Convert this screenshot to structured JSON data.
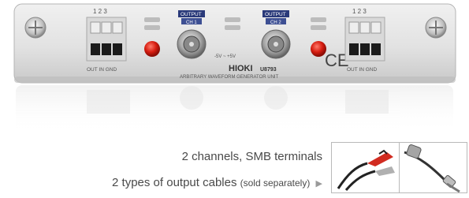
{
  "product_image": {
    "left_channel": {
      "pin_numbers": "1 2 3",
      "output_label": "OUT IN GND"
    },
    "left_connector_label": "OUTPUT",
    "left_connector_sublabel": "CH 1",
    "right_connector_label": "OUTPUT",
    "right_connector_sublabel": "CH 2",
    "range_label": "-5V ~ +5V",
    "brand": "HIOKI",
    "model": "U8793",
    "description": "ARBITRARY WAVEFORM GENERATOR UNIT",
    "right_channel": {
      "pin_numbers": "1 2 3",
      "output_label": "OUT IN GND"
    },
    "ce_mark": "CE"
  },
  "captions": {
    "line1": "2 channels, SMB terminals",
    "line2_main": "2 types of output cables",
    "line2_note": "(sold separately)",
    "line2_arrow": "▶"
  },
  "thumbnails": {
    "cable_clip_alt": "clip-lead-cable",
    "cable_bnc_alt": "bnc-cable"
  }
}
